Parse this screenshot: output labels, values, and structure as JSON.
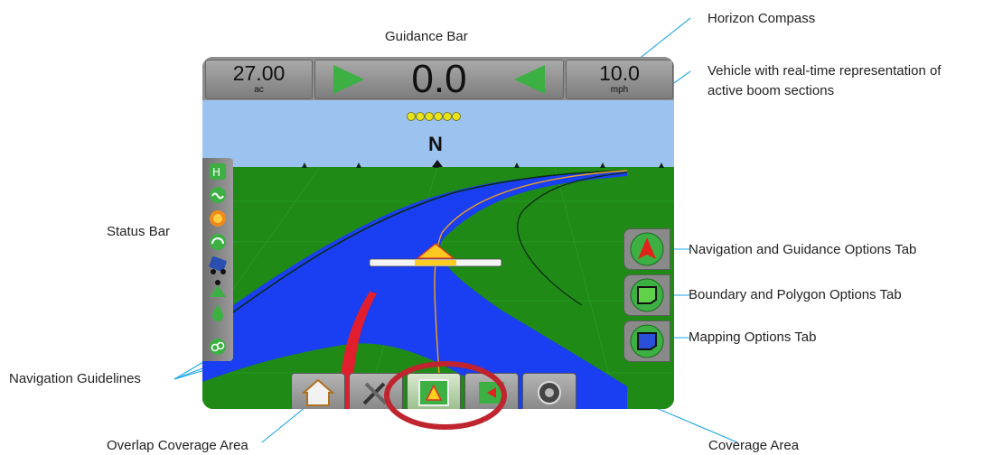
{
  "callouts": {
    "guidance_bar": "Guidance Bar",
    "horizon_compass": "Horizon Compass",
    "vehicle_line1": "Vehicle with real-time representation of",
    "vehicle_line2": "active boom sections",
    "status_bar": "Status Bar",
    "nav_guidance_tab": "Navigation and Guidance Options Tab",
    "boundary_polygon_tab": "Boundary and Polygon Options Tab",
    "mapping_tab": "Mapping Options Tab",
    "navigation_guidelines": "Navigation Guidelines",
    "overlap_coverage_area": "Overlap Coverage Area",
    "coverage_area": "Coverage Area"
  },
  "guidance_bar": {
    "area_value": "27.00",
    "area_unit": "ac",
    "cross_track": "0.0",
    "speed_value": "10.0",
    "speed_unit": "mph"
  },
  "compass": {
    "heading": "N"
  },
  "colors": {
    "sky": "#9cc3f0",
    "field": "#1f8a16",
    "coverage": "#1a3ef2",
    "overlap": "#e01e2e",
    "highlight_ring": "#c0242f",
    "leader_line": "#1aa3e8",
    "arrow_green": "#3cb043"
  },
  "icons": {
    "status_bar": [
      "rtk-gps-icon",
      "steering-icon",
      "boom-auto-icon",
      "pressure-icon",
      "vehicle-tilt-icon",
      "boom-height-icon",
      "tank-icon",
      "link-icon"
    ],
    "right_tabs": [
      "navigation-arrow-icon",
      "boundary-icon",
      "mapping-icon"
    ],
    "bottom_tabs": [
      "home-icon",
      "tools-icon",
      "guidance-view-icon",
      "field-view-icon",
      "camera-icon"
    ]
  }
}
